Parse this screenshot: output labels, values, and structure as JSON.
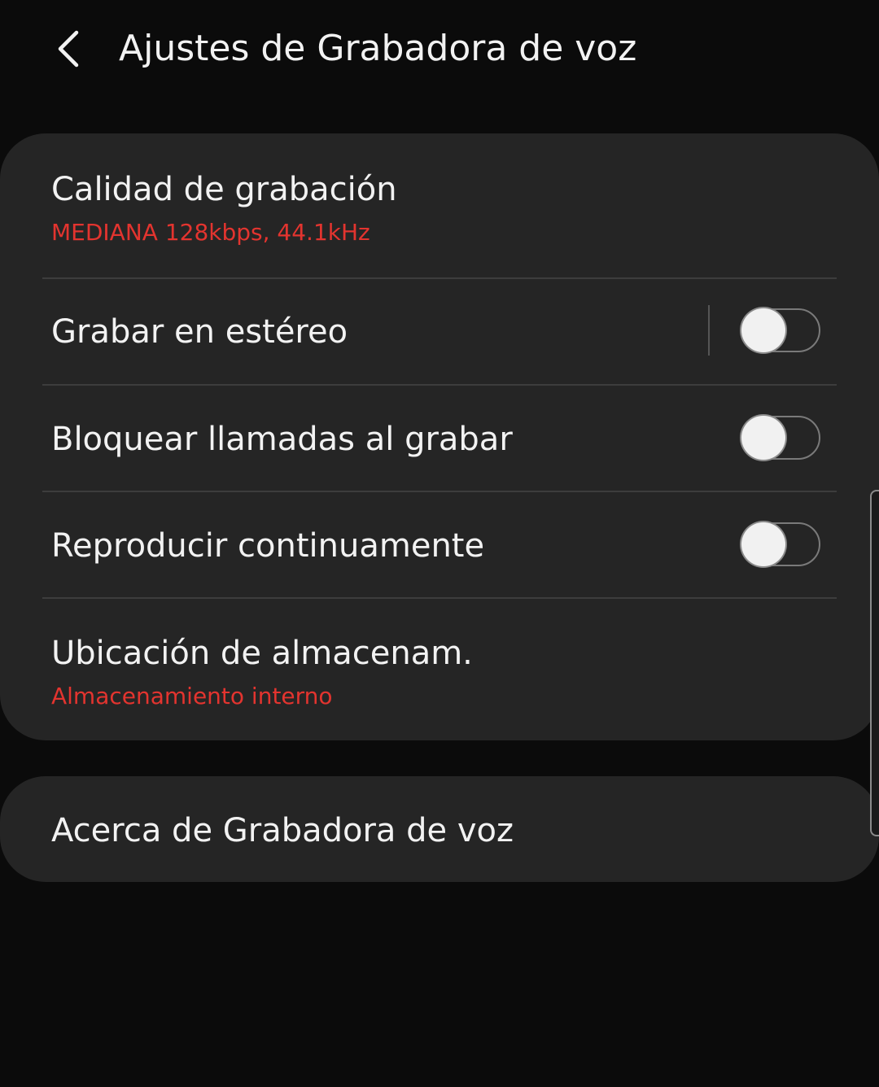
{
  "header": {
    "back_icon": "chevron-left-icon",
    "title": "Ajustes de Grabadora de voz"
  },
  "settings": {
    "recording_quality": {
      "title": "Calidad de grabación",
      "value": "MEDIANA 128kbps, 44.1kHz"
    },
    "stereo": {
      "title": "Grabar en estéreo",
      "enabled": false
    },
    "block_calls": {
      "title": "Bloquear llamadas al grabar",
      "enabled": false
    },
    "continuous_play": {
      "title": "Reproducir continuamente",
      "enabled": false
    },
    "storage_location": {
      "title": "Ubicación de almacenam.",
      "value": "Almacenamiento interno"
    }
  },
  "about": {
    "title": "Acerca de Grabadora de voz"
  },
  "colors": {
    "background": "#0b0b0b",
    "card": "#252525",
    "accent_red": "#e3342f",
    "text": "#f2f2f2"
  }
}
